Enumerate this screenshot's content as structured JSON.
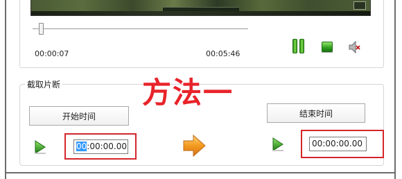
{
  "player": {
    "current_time": "00:00:07",
    "total_time": "00:05:46",
    "controls": {
      "pause_icon": "pause-icon",
      "stop_icon": "stop-icon",
      "mute_icon": "speaker-muted-icon"
    }
  },
  "clip": {
    "group_label": "截取片断",
    "annotation": "方法一",
    "start_button_label": "开始时间",
    "end_button_label": "结束时间",
    "start_time_selected": "00",
    "start_time_rest": ":00:00.00",
    "end_time": "00:00:00.00",
    "play_icon": "green-play-icon",
    "arrow_icon": "orange-right-arrow-icon"
  },
  "colors": {
    "annotation_red": "#e8232a",
    "highlight_box_red": "#d4252a",
    "play_green": "#2f9e1f",
    "arrow_orange": "#f39a1e",
    "selection_blue": "#3399ff"
  }
}
